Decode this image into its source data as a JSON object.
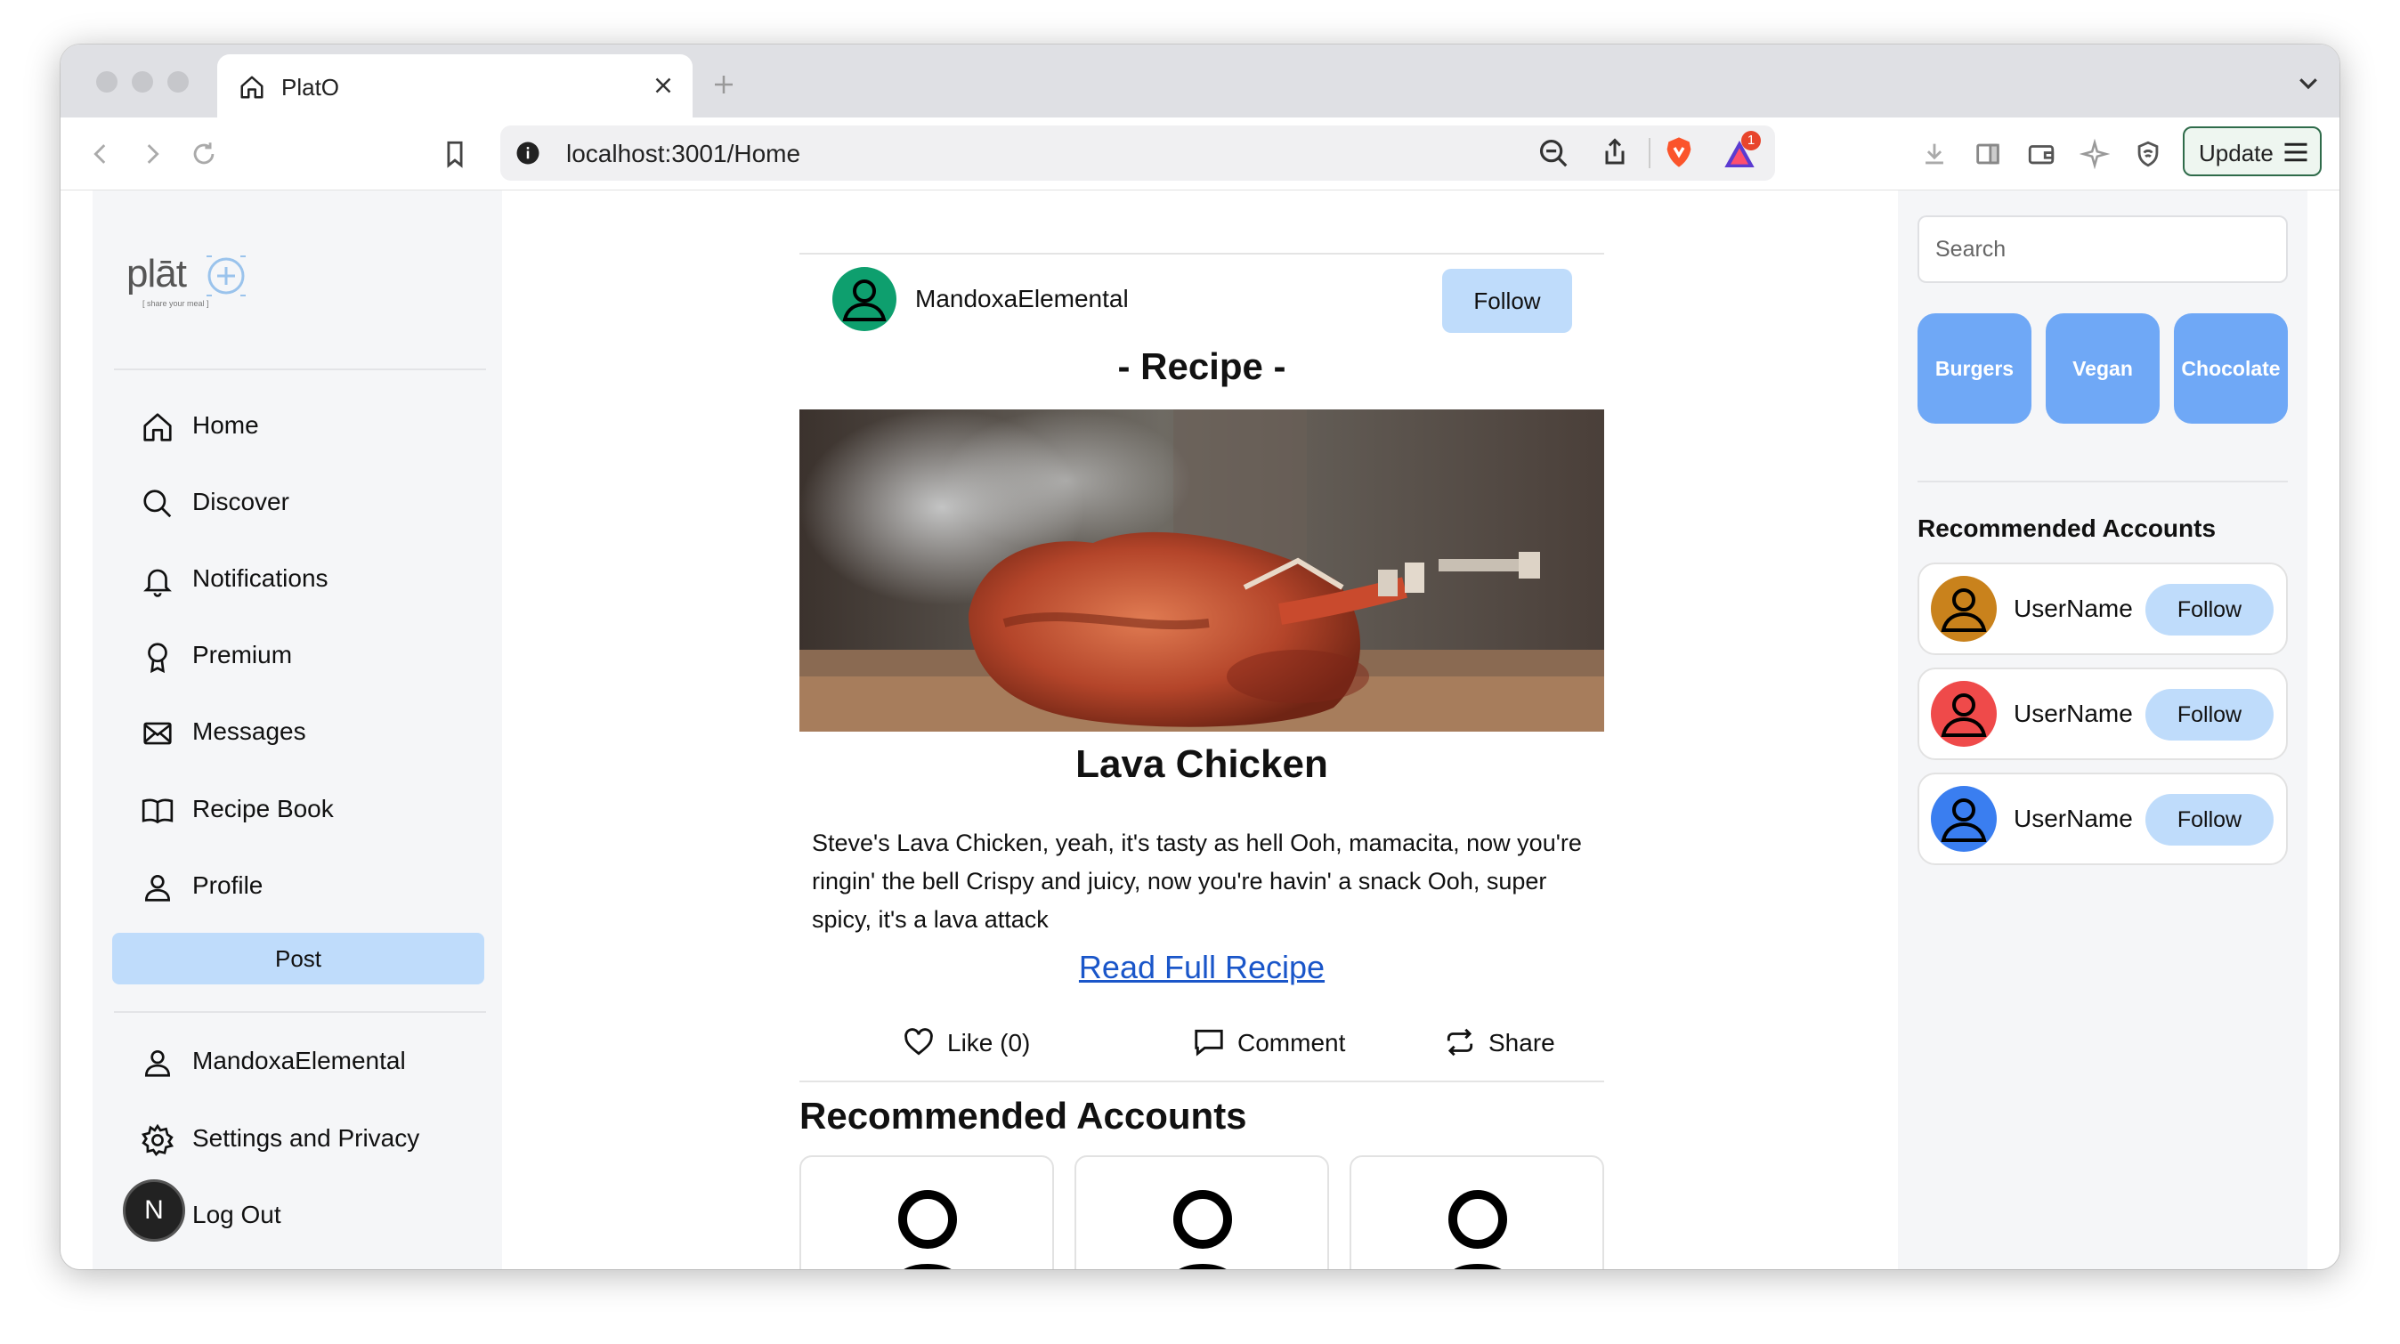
{
  "browser": {
    "tab_title": "PlatO",
    "url": "localhost:3001/Home",
    "notification_count": "1",
    "update_label": "Update"
  },
  "sidebar": {
    "logo_text": "plāt",
    "logo_tagline": "[ share your meal ]",
    "items": [
      {
        "label": "Home",
        "icon": "home-icon"
      },
      {
        "label": "Discover",
        "icon": "search-icon"
      },
      {
        "label": "Notifications",
        "icon": "bell-icon"
      },
      {
        "label": "Premium",
        "icon": "award-icon"
      },
      {
        "label": "Messages",
        "icon": "mail-icon"
      },
      {
        "label": "Recipe Book",
        "icon": "book-icon"
      },
      {
        "label": "Profile",
        "icon": "user-icon"
      }
    ],
    "post_label": "Post",
    "account": {
      "username": "MandoxaElemental",
      "settings_label": "Settings and Privacy",
      "logout_label": "Log Out"
    },
    "dev_badge": "N"
  },
  "post": {
    "username": "MandoxaElemental",
    "follow_label": "Follow",
    "heading": "- Recipe -",
    "title": "Lava Chicken",
    "description": "Steve's Lava Chicken, yeah, it's tasty as hell Ooh, mamacita, now you're ringin' the bell Crispy and juicy, now you're havin' a snack Ooh, super spicy, it's a lava attack",
    "read_more_label": "Read Full Recipe",
    "actions": {
      "like_label": "Like (0)",
      "comment_label": "Comment",
      "share_label": "Share"
    },
    "avatar_color": "#0e9f6e"
  },
  "recommended_main": {
    "heading": "Recommended Accounts"
  },
  "right_sidebar": {
    "search_placeholder": "Search",
    "chips": [
      "Burgers",
      "Vegan",
      "Chocolate"
    ],
    "heading": "Recommended Accounts",
    "accounts": [
      {
        "name": "UserName",
        "follow_label": "Follow",
        "avatar_color": "#c9821c"
      },
      {
        "name": "UserName",
        "follow_label": "Follow",
        "avatar_color": "#ef4a4a"
      },
      {
        "name": "UserName",
        "follow_label": "Follow",
        "avatar_color": "#3a7ef0"
      }
    ]
  },
  "colors": {
    "accent_light_blue": "#bfdcfb",
    "chip_blue": "#6fa8f6",
    "link_blue": "#1a56c9"
  }
}
